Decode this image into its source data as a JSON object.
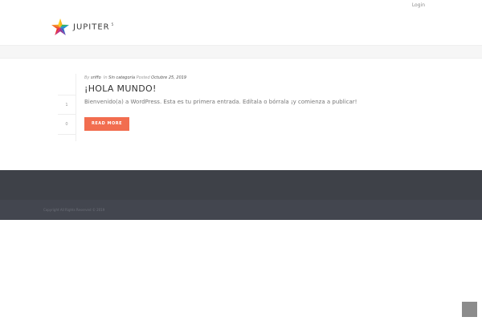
{
  "topbar": {
    "login_label": "Login"
  },
  "logo": {
    "text": "JUPITER",
    "superscript": "5",
    "icon": "colorful-star-icon",
    "colors": [
      "#e8332b",
      "#f7b21c",
      "#2fb45a",
      "#1f8fd6",
      "#8b3ea0"
    ]
  },
  "post": {
    "meta": {
      "by_prefix": "By",
      "author": "sriffo",
      "in_prefix": "In",
      "category": "Sin categoría",
      "posted_prefix": "Posted",
      "date": "Octubre 25, 2019"
    },
    "side": {
      "likes": "1",
      "comments": "0"
    },
    "title": "¡HOLA MUNDO!",
    "excerpt": "Bienvenido(a) a WordPress. Esta es tu primera entrada. Edítala o bórrala ¡y comienza a publicar!",
    "read_more_label": "READ MORE",
    "accent_color": "#f26d4f"
  },
  "footer": {
    "copyright": "Copyright All Rights Reserved © 2019",
    "bg_color": "#3e4148",
    "sub_bg_color": "#43464f"
  },
  "scroll_top": {
    "icon": "scroll-to-top-icon"
  }
}
